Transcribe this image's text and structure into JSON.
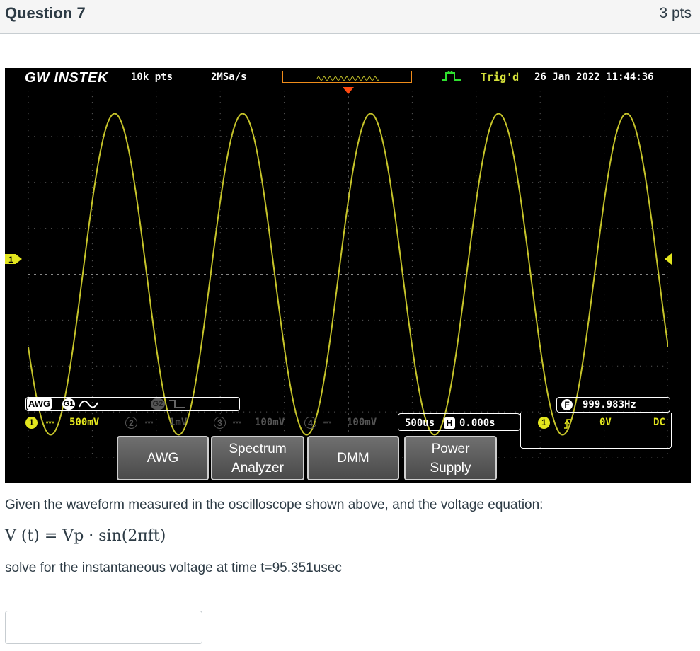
{
  "question": {
    "title": "Question 7",
    "points": "3 pts"
  },
  "scope": {
    "brand": "GW INSTEK",
    "record_length": "10k pts",
    "sample_rate": "2MSa/s",
    "trigger_status": "Trig'd",
    "datetime": "26 Jan 2022 11:44:36",
    "ch1_marker": "1",
    "awg_label": "AWG",
    "awg_g1": "G1",
    "awg_g2": "G2",
    "freq_badge": "F",
    "frequency": "999.983Hz",
    "channels": [
      {
        "num": "1",
        "coupling": "⎓",
        "scale": "500mV",
        "color": "#e3e61e"
      },
      {
        "num": "2",
        "coupling": "⎓",
        "scale": "1mV",
        "color": "#555555"
      },
      {
        "num": "3",
        "coupling": "⎓",
        "scale": "100mV",
        "color": "#555555"
      },
      {
        "num": "4",
        "coupling": "⎓",
        "scale": "100mV",
        "color": "#555555"
      }
    ],
    "timebase": "500us",
    "h_badge": "H",
    "h_position": "0.000s",
    "trig_source": "1",
    "trig_level": "0V",
    "trig_coupling": "DC",
    "softkeys": [
      "AWG",
      "Spectrum\nAnalyzer",
      "DMM",
      "Power\nSupply"
    ],
    "trace_color": "#c6c42a",
    "waveform": {
      "period_divisions": 2.0,
      "amplitude_divisions": 3.5,
      "phase_at_left_div": 0.85
    }
  },
  "prompt": "Given the waveform measured in the oscilloscope shown above, and the voltage equation:",
  "equation": {
    "lhs": "V (t) = Vp · sin(2πft)"
  },
  "instruction": "solve for the instantaneous voltage at time t=95.351usec",
  "answer": {
    "value": ""
  }
}
